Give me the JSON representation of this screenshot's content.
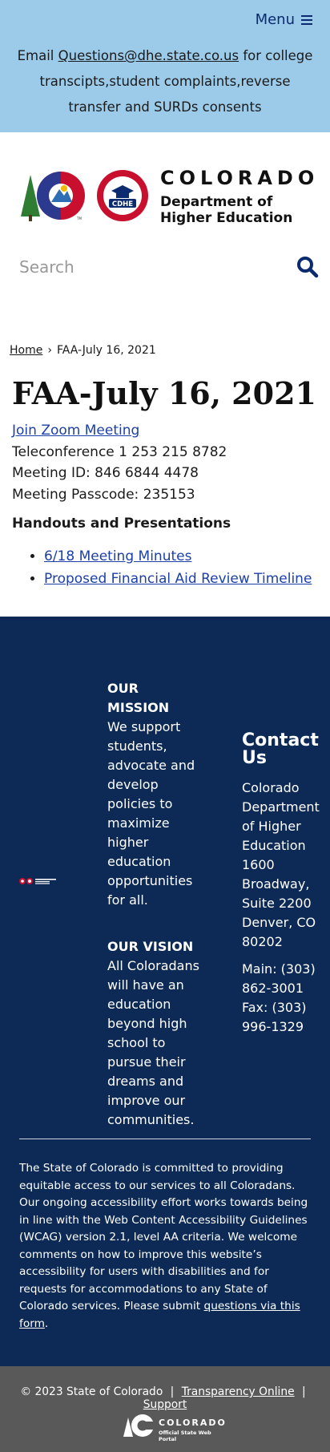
{
  "header": {
    "menu_label": "Menu",
    "notice_prefix": "Email ",
    "notice_email": "Questions@dhe.state.co.us",
    "notice_suffix": " for college transcipts,student complaints,reverse transfer and SURDs consents"
  },
  "logo": {
    "state": "COLORADO",
    "dept_line1": "Department of",
    "dept_line2": "Higher Education",
    "badge": "CDHE",
    "tm": "TM"
  },
  "search": {
    "placeholder": "Search"
  },
  "breadcrumb": {
    "home": "Home",
    "separator": "›",
    "current": "FAA-July 16, 2021"
  },
  "main": {
    "title": "FAA-July 16, 2021",
    "zoom_link": "Join Zoom Meeting",
    "teleconference": "Teleconference 1 253 215 8782",
    "meeting_id": "Meeting ID: 846 6844 4478",
    "passcode": "Meeting Passcode: 235153",
    "handouts_heading": "Handouts and Presentations",
    "handouts": [
      {
        "label": "6/18 Meeting Minutes"
      },
      {
        "label": "Proposed Financial Aid Review Timeline"
      }
    ]
  },
  "footer": {
    "mission_heading": "OUR MISSION",
    "mission_text": "We support students, advocate and develop policies to maximize higher education opportunities for all.",
    "vision_heading": "OUR VISION",
    "vision_text": "All Coloradans will have an education beyond high school to pursue their dreams and improve our communities.",
    "contact_heading": "Contact Us",
    "contact_address": "Colorado Department of Higher Education 1600 Broadway, Suite 2200 Denver, CO 80202",
    "contact_main": "Main: (303) 862-3001",
    "contact_fax": "Fax: (303) 996-1329",
    "accessibility_text": "The State of Colorado is committed to providing equitable access to our services to all Coloradans. Our ongoing accessibility effort works towards being in line with the Web Content Accessibility Guidelines (WCAG) version 2.1, level AA criteria. We welcome comments on how to improve this website’s accessibility for users with disabilities and for requests for accommodations to any State of Colorado services. Please submit ",
    "accessibility_link": "questions via this form",
    "accessibility_end": "."
  },
  "bottombar": {
    "copyright": "© 2023 State of Colorado",
    "separator": "|",
    "transparency": "Transparency Online",
    "support": "Support",
    "portal_name": "COLORADO",
    "portal_sub": "Official State Web Portal"
  },
  "colors": {
    "banner": "#9ccbea",
    "footer": "#0c2a55",
    "bottombar": "#595959",
    "link": "#1c3fa8",
    "brand_navy": "#0b2a6f"
  }
}
